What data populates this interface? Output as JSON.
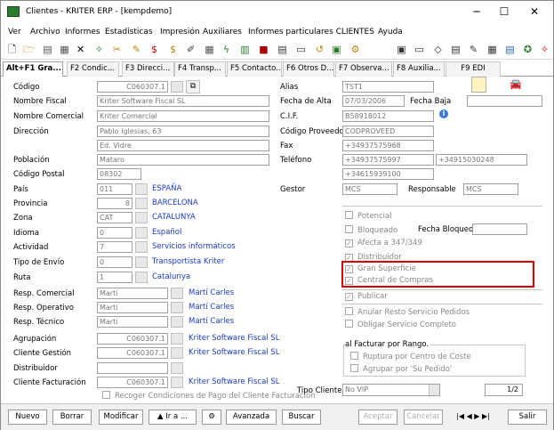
{
  "window": {
    "title": "Clientes - KRITER ERP - [kempdemo]",
    "min": "─",
    "max": "☐",
    "close": "✕"
  },
  "menu": [
    "Ver",
    "Archivo",
    "Informes",
    "Estadísticas",
    "Impresión",
    "Auxiliares",
    "Informes particulares CLIENTES",
    "Ayuda"
  ],
  "tabs": [
    "Alt+F1 Gra...",
    "F2 Condic...",
    "F3 Direcci...",
    "F4 Transp...",
    "F5 Contacto...",
    "F6 Otros D...",
    "F7 Observa...",
    "F8 Auxilia...",
    "F9 EDI"
  ],
  "labels": {
    "codigo": "Código",
    "nombre_fiscal": "Nombre Fiscal",
    "nombre_comercial": "Nombre Comercial",
    "direccion": "Dirección",
    "poblacion": "Población",
    "codigo_postal": "Código Postal",
    "pais": "País",
    "provincia": "Provincia",
    "zona": "Zona",
    "idioma": "Idioma",
    "actividad": "Actividad",
    "tipo_envio": "Tipo de Envío",
    "ruta": "Ruta",
    "resp_comercial": "Resp. Comercial",
    "resp_operativo": "Resp. Operativo",
    "resp_tecnico": "Resp. Técnico",
    "agrupacion": "Agrupación",
    "cliente_gestion": "Cliente Gestión",
    "distribuidor": "Distribuidor",
    "cliente_facturacion": "Cliente Facturación",
    "alias": "Alias",
    "fecha_alta": "Fecha de Alta",
    "fecha_baja": "Fecha Baja",
    "cif": "C.I.F.",
    "codigo_proveedor": "Código Proveedor",
    "fax": "Fax",
    "telefono": "Teléfono",
    "gestor": "Gestor",
    "responsable": "Responsable",
    "tipo_cliente": "Tipo Cliente:",
    "fecha_bloqueo": "Fecha Bloqueo",
    "facturar_rango": "al Facturar por Rango."
  },
  "values": {
    "codigo": "C060307.1",
    "nombre_fiscal": "Kriter Software Fiscal SL",
    "nombre_comercial": "Kriter Comercial",
    "direccion1": "Pablo Iglesias, 63",
    "direccion2": "Ed. Vidre",
    "poblacion": "Mataro",
    "codigo_postal": "08302",
    "pais": "011",
    "provincia": "8",
    "zona": "CAT",
    "idioma": "0",
    "actividad": "7",
    "tipo_envio": "0",
    "ruta": "1",
    "resp_comercial": "Marti",
    "resp_operativo": "Marti",
    "resp_tecnico": "Marti",
    "agrupacion": "C060307.1",
    "cliente_gestion": "C060307.1",
    "distribuidor": "",
    "cliente_facturacion": "C060307.1",
    "alias": "TST1",
    "fecha_alta": "07/03/2006",
    "fecha_baja": "",
    "cif": "B58918012",
    "codigo_proveedor": "CODPROVEED",
    "fax": "+34937575968",
    "telefono1": "+34937575997",
    "telefono2": "+34915030248",
    "telefono3": "+34615939100",
    "gestor": "MCS",
    "responsable": "MCS",
    "tipo_cliente": "No VIP",
    "page": "1/2"
  },
  "links": {
    "pais": "ESPAÑA",
    "provincia": "BARCELONA",
    "zona": "CATALUNYA",
    "idioma": "Español",
    "actividad": "Servicios informáticos",
    "tipo_envio": "Transportista Kriter",
    "ruta": "Catalunya",
    "resp_comercial": "Martí Carles",
    "resp_operativo": "Martí Carles",
    "resp_tecnico": "Martí Carles",
    "agrupacion": "Kriter Software Fiscal SL",
    "cliente_gestion": "Kriter Software Fiscal SL",
    "cliente_facturacion": "Kriter Software Fiscal SL"
  },
  "checks": {
    "potencial": "Potencial",
    "bloqueado": "Bloqueado",
    "afecta": "Afecta a 347/349",
    "distribuidor": "Distribuidor",
    "gran_superficie": "Gran Superficie",
    "central_compras": "Central de Compras",
    "publicar": "Publicar",
    "anular": "Anular Resto Servicio Pedidos",
    "obligar": "Obligar Servicio Completo",
    "ruptura": "Ruptura por Centro de Coste",
    "agrupar": "Agrupar por 'Su Pedido'",
    "recoger": "Recoger Condiciones de Pago del Cliente Facturación"
  },
  "buttons": {
    "nuevo": "Nuevo",
    "borrar": "Borrar",
    "modificar": "Modificar",
    "ira": "▲ Ir a ...",
    "avanzada": "Avanzada",
    "buscar": "Buscar",
    "aceptar": "Aceptar",
    "cancelar": "Cancelar",
    "salir": "Salir"
  },
  "colors": {
    "link": "#1a3ccc",
    "highlight": "#e00000"
  }
}
